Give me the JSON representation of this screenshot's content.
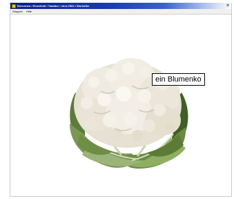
{
  "window": {
    "title": "Benennen / Einzelbild / Tastatur / ohne Hilfe / Wortsilbe",
    "close_glyph": "✕"
  },
  "menu": {
    "items": [
      {
        "label": "Stoppen"
      },
      {
        "label": "Hilfe"
      }
    ]
  },
  "stage": {
    "word_label": "ein Blumenko"
  },
  "icons": {
    "app": "app-icon",
    "close": "close-icon"
  }
}
